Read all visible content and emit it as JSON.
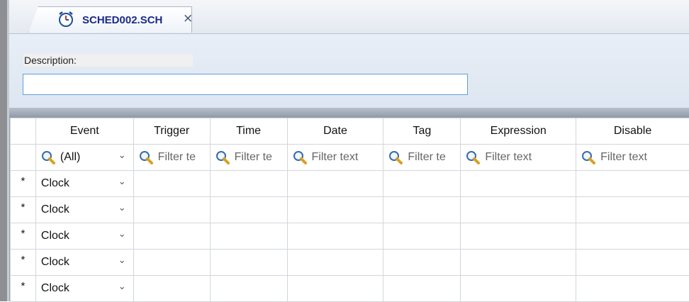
{
  "tab": {
    "title": "SCHED002.SCH",
    "close_glyph": "×",
    "icon": "alarm-clock-icon"
  },
  "description": {
    "label": "Description:",
    "value": "",
    "placeholder": ""
  },
  "grid": {
    "row_marker": "*",
    "columns": [
      "Event",
      "Trigger",
      "Time",
      "Date",
      "Tag",
      "Expression",
      "Disable"
    ],
    "filters": {
      "event_selected": "(All)",
      "placeholders": [
        "Filter te",
        "Filter te",
        "Filter text",
        "Filter te",
        "Filter text",
        "Filter text"
      ]
    },
    "rows": [
      {
        "event": "Clock"
      },
      {
        "event": "Clock"
      },
      {
        "event": "Clock"
      },
      {
        "event": "Clock"
      },
      {
        "event": "Clock"
      }
    ]
  },
  "colors": {
    "tab_title": "#1a2a8a",
    "input_border": "#5f9fd8",
    "panel_bg": "#e2e9f3"
  }
}
